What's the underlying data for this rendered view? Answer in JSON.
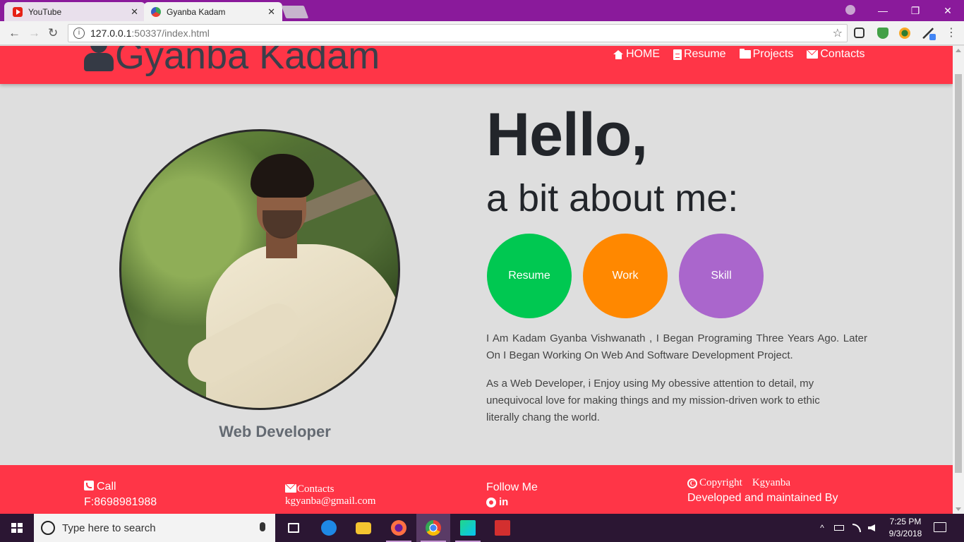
{
  "browser": {
    "tabs": [
      {
        "title": "YouTube",
        "icon": "youtube-icon",
        "close": "✕"
      },
      {
        "title": "Gyanba Kadam",
        "icon": "site-icon",
        "close": "✕"
      }
    ],
    "url_host": "127.0.0.1",
    "url_rest": ":50337/index.html",
    "nav": {
      "back": "←",
      "forward": "→",
      "reload": "↻",
      "info": "i",
      "star": "☆"
    },
    "window": {
      "minimize": "—",
      "maximize": "❐",
      "close": "✕"
    }
  },
  "site": {
    "brand": "Gyanba Kadam",
    "nav": [
      {
        "label": "HOME",
        "icon": "home-icon"
      },
      {
        "label": "Resume",
        "icon": "file-icon"
      },
      {
        "label": "Projects",
        "icon": "folder-icon"
      },
      {
        "label": "Contacts",
        "icon": "envelope-icon"
      }
    ],
    "hero": {
      "greeting": "Hello,",
      "subtitle": "a bit about me:",
      "role": "Web Developer",
      "buttons": [
        "Resume",
        "Work",
        "Skill"
      ],
      "bio_1": "I Am Kadam Gyanba Vishwanath , I Began Programing Three Years Ago. Later On I Began Working On Web And Software Development Project.",
      "bio_2": "As a Web Developer, i Enjoy using My obessive attention to detail, my unequivocal love for making things and my mission-driven work to ethic literally chang the world."
    },
    "footer": {
      "call_label": "Call",
      "phone": "F:8698981988",
      "contacts_label": "Contacts",
      "email": "kgyanba@gmail.com",
      "follow_label": "Follow Me",
      "linkedin": "in",
      "copyright_label": "Copyright",
      "copyright_symbol": "C",
      "copyright_name": "Kgyanba",
      "maintained": "Developed and maintained By"
    },
    "colors": {
      "primary": "#ff3547",
      "resume": "#00c851",
      "work": "#ff8800",
      "skill": "#aa66cc"
    }
  },
  "taskbar": {
    "search_placeholder": "Type here to search",
    "time": "7:25 PM",
    "date": "9/3/2018",
    "tray_chevron": "^"
  }
}
